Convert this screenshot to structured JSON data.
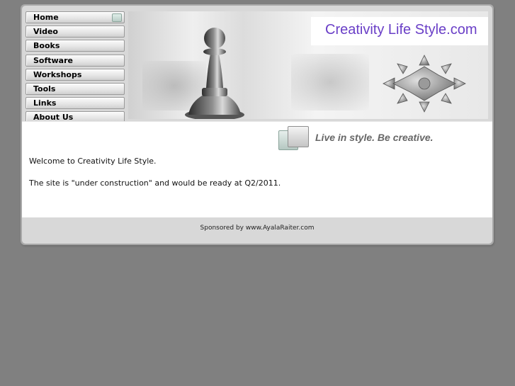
{
  "nav": {
    "items": [
      {
        "label": "Home",
        "active": true
      },
      {
        "label": "Video"
      },
      {
        "label": "Books"
      },
      {
        "label": "Software"
      },
      {
        "label": "Workshops"
      },
      {
        "label": "Tools"
      },
      {
        "label": "Links"
      },
      {
        "label": "About Us"
      }
    ]
  },
  "banner": {
    "title": "Creativity Life Style.com",
    "title_color": "#6a3fc7"
  },
  "tagline": "Live in style. Be creative.",
  "content": {
    "welcome": "Welcome to Creativity Life Style.",
    "status": "The site is \"under construction\" and would be ready at Q2/2011."
  },
  "footer": {
    "sponsor": "Sponsored by www.AyalaRaiter.com"
  }
}
